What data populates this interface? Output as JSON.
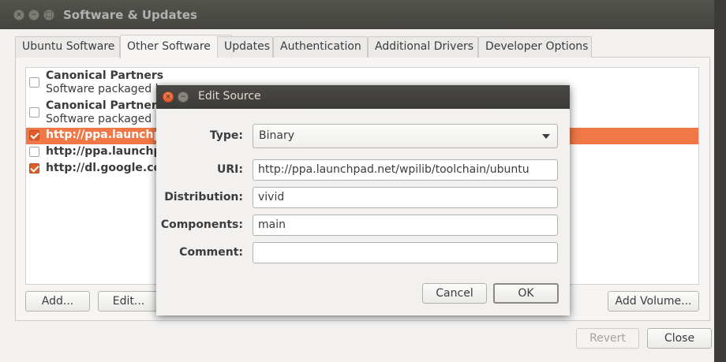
{
  "window": {
    "title": "Software & Updates",
    "close_glyph": "×",
    "min_glyph": "−",
    "max_glyph": "□"
  },
  "tabs": [
    {
      "label": "Ubuntu Software"
    },
    {
      "label": "Other Software",
      "active": true
    },
    {
      "label": "Updates"
    },
    {
      "label": "Authentication"
    },
    {
      "label": "Additional Drivers"
    },
    {
      "label": "Developer Options"
    }
  ],
  "sources": [
    {
      "title": "Canonical Partners",
      "subtitle": "Software packaged by",
      "checked": false
    },
    {
      "title": "Canonical Partners",
      "subtitle": "Software packaged by",
      "checked": false
    },
    {
      "title": "http://ppa.launchpa",
      "checked": true,
      "selected": true
    },
    {
      "title": "http://ppa.launchpa",
      "checked": false
    },
    {
      "title": "http://dl.google.co",
      "checked": true
    }
  ],
  "list_buttons": {
    "add": "Add...",
    "edit": "Edit...",
    "add_volume": "Add Volume..."
  },
  "footer_buttons": {
    "revert": "Revert",
    "close": "Close"
  },
  "dialog": {
    "title": "Edit Source",
    "close_glyph": "×",
    "min_glyph": "−",
    "type_label": "Type:",
    "type_value": "Binary",
    "uri_label": "URI:",
    "uri_value": "http://ppa.launchpad.net/wpilib/toolchain/ubuntu",
    "distribution_label": "Distribution:",
    "distribution_value": "vivid",
    "components_label": "Components:",
    "components_value": "main",
    "comment_label": "Comment:",
    "comment_value": "",
    "cancel": "Cancel",
    "ok": "OK"
  },
  "colors": {
    "selection": "#f07746",
    "checkbox_checked": "#df5c2b",
    "titlebar": "#3c3b37"
  }
}
